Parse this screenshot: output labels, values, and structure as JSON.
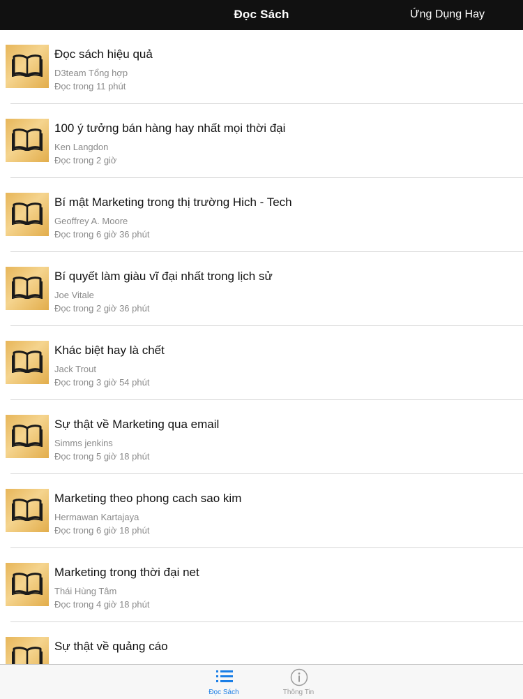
{
  "header": {
    "title": "Đọc Sách",
    "right_label": "Ứng Dụng Hay"
  },
  "books": [
    {
      "title": "Đọc sách hiệu quả",
      "author": "D3team Tổng hợp",
      "duration": "Đọc trong 11 phút"
    },
    {
      "title": "100 ý tưởng bán hàng hay nhất mọi thời đại",
      "author": "Ken Langdon",
      "duration": "Đọc trong 2 giờ"
    },
    {
      "title": "Bí mật Marketing trong thị trường Hich - Tech",
      "author": "Geoffrey A. Moore",
      "duration": "Đọc trong 6 giờ 36 phút"
    },
    {
      "title": "Bí quyết làm giàu vĩ đại nhất trong lịch sử",
      "author": "Joe Vitale",
      "duration": "Đọc trong 2 giờ 36 phút"
    },
    {
      "title": "Khác biệt hay là chết",
      "author": "Jack Trout",
      "duration": "Đọc trong 3 giờ 54 phút"
    },
    {
      "title": "Sự thật về Marketing qua email",
      "author": "Simms jenkins",
      "duration": "Đọc trong 5 giờ 18 phút"
    },
    {
      "title": "Marketing theo phong cach sao kim",
      "author": "Hermawan Kartajaya",
      "duration": "Đọc trong 6 giờ 18 phút"
    },
    {
      "title": "Marketing trong thời đại net",
      "author": "Thái Hùng Tâm",
      "duration": "Đọc trong 4 giờ 18 phút"
    },
    {
      "title": "Sự thật về quảng cáo",
      "author": "",
      "duration": ""
    }
  ],
  "tabbar": {
    "tabs": [
      {
        "label": "Đọc Sách",
        "icon": "list-icon",
        "active": true
      },
      {
        "label": "Thông Tin",
        "icon": "info-icon",
        "active": false
      }
    ]
  },
  "colors": {
    "navbar": "#111111",
    "accent": "#1a7ee6",
    "thumb": "#e7b65a"
  }
}
